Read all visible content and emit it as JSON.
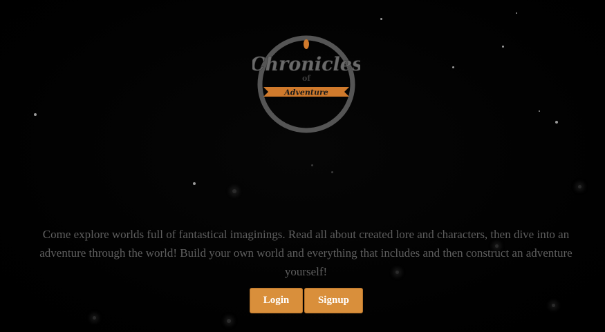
{
  "logo": {
    "title": "Chronicles",
    "of": "of",
    "banner": "Adventure",
    "ring_color": "#555555",
    "accent_color": "#d07a2c"
  },
  "intro": {
    "text": "Come explore worlds full of fantastical imaginings. Read all about created lore and characters, then dive into an adventure through the world! Build your own world and everything that includes and then construct an adventure yourself!"
  },
  "actions": {
    "login_label": "Login",
    "signup_label": "Signup",
    "button_color": "#d98f3b"
  }
}
